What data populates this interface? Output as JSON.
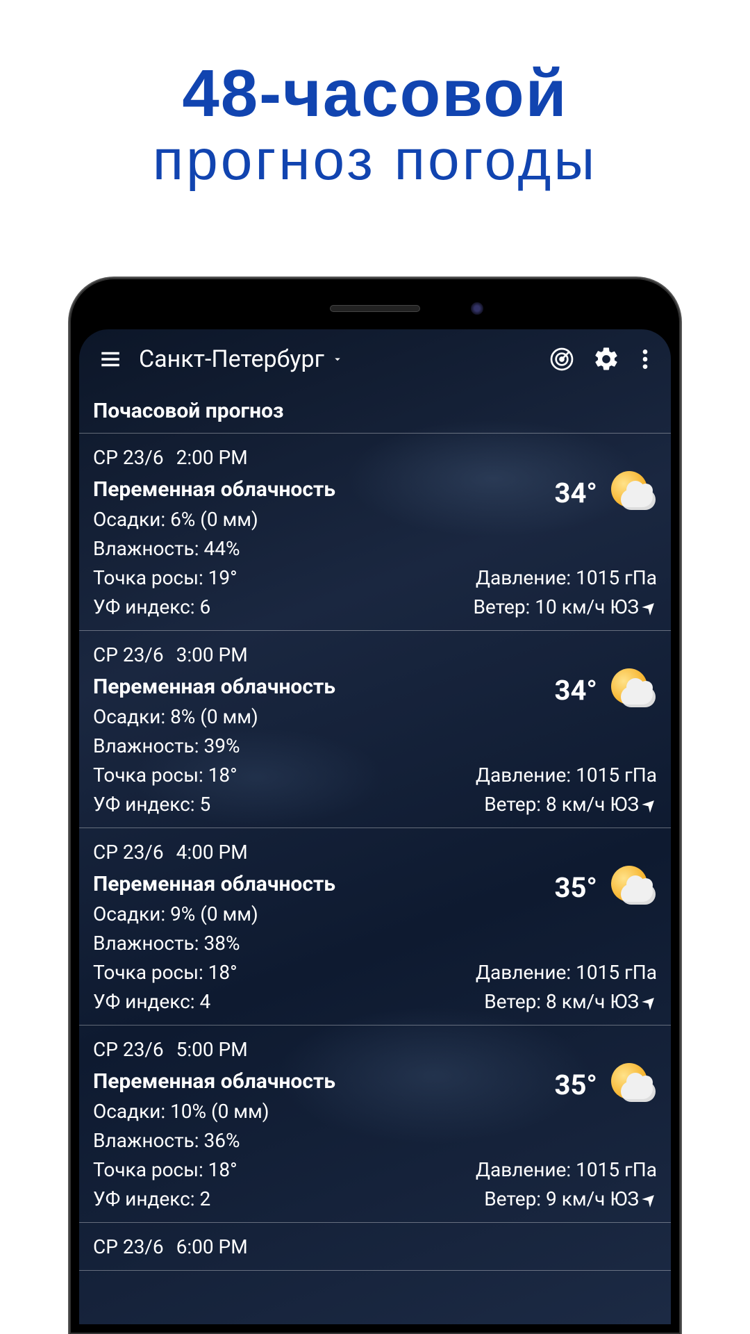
{
  "promo": {
    "line1": "48-часовой",
    "line2": "прогноз погоды"
  },
  "header": {
    "location": "Санкт-Петербург"
  },
  "section_title": "Почасовой прогноз",
  "labels": {
    "precip": "Осадки:",
    "humidity": "Влажность:",
    "dew": "Точка росы:",
    "uv": "УФ индекс:",
    "pressure": "Давление:",
    "wind": "Ветер:"
  },
  "hours": [
    {
      "day": "СР 23/6",
      "time": "2:00 PM",
      "condition": "Переменная облачность",
      "precip": "6% (0 мм)",
      "humidity": "44%",
      "dew": "19°",
      "uv": "6",
      "temp": "34°",
      "pressure": "1015 гПа",
      "wind": "10 км/ч ЮЗ"
    },
    {
      "day": "СР 23/6",
      "time": "3:00 PM",
      "condition": "Переменная облачность",
      "precip": "8% (0 мм)",
      "humidity": "39%",
      "dew": "18°",
      "uv": "5",
      "temp": "34°",
      "pressure": "1015 гПа",
      "wind": "8 км/ч ЮЗ"
    },
    {
      "day": "СР 23/6",
      "time": "4:00 PM",
      "condition": "Переменная облачность",
      "precip": "9% (0 мм)",
      "humidity": "38%",
      "dew": "18°",
      "uv": "4",
      "temp": "35°",
      "pressure": "1015 гПа",
      "wind": "8 км/ч ЮЗ"
    },
    {
      "day": "СР 23/6",
      "time": "5:00 PM",
      "condition": "Переменная облачность",
      "precip": "10% (0 мм)",
      "humidity": "36%",
      "dew": "18°",
      "uv": "2",
      "temp": "35°",
      "pressure": "1015 гПа",
      "wind": "9 км/ч ЮЗ"
    },
    {
      "day": "СР 23/6",
      "time": "6:00 PM",
      "condition": "",
      "precip": "",
      "humidity": "",
      "dew": "",
      "uv": "",
      "temp": "",
      "pressure": "",
      "wind": ""
    }
  ]
}
